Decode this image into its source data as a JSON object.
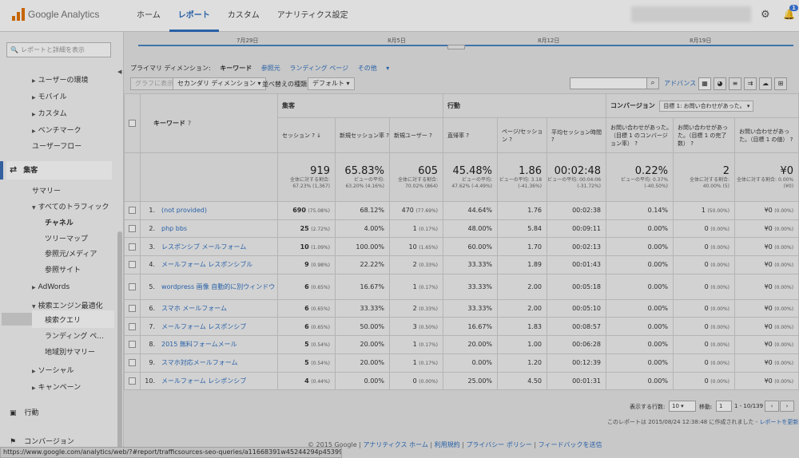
{
  "app": {
    "logo_text": "Google Analytics",
    "account_blurred": "▒▒▒▒▒▒▒▒▒▒▒▒▒▒▒▒▒▒",
    "bell_count": "1"
  },
  "nav": {
    "home": "ホーム",
    "reports": "レポート",
    "custom": "カスタム",
    "admin": "アナリティクス設定"
  },
  "sidebar": {
    "search_placeholder": "レポートと詳細を表示",
    "items": [
      "ユーザーの環境",
      "モバイル",
      "カスタム",
      "ベンチマーク",
      "ユーザーフロー",
      "集客",
      "サマリー",
      "すべてのトラフィック",
      "チャネル",
      "ツリーマップ",
      "参照元/メディア",
      "参照サイト",
      "AdWords",
      "検索エンジン最適化",
      "検索クエリ",
      "ランディング ペ...",
      "地域別サマリー",
      "ソーシャル",
      "キャンペーン",
      "行動",
      "コンバージョン"
    ]
  },
  "timeline": {
    "dates": [
      "7月29日",
      "8月5日",
      "8月12日",
      "8月19日"
    ]
  },
  "dimension": {
    "label": "プライマリ ディメンション:",
    "current": "キーワード",
    "options": [
      "参照元",
      "ランディング ページ",
      "その他"
    ]
  },
  "toolbar": {
    "plot": "グラフに表示",
    "secondary": "セカンダリ ディメンション",
    "sort_label": "並べ替えの種類:",
    "sort_value": "デフォルト",
    "advanced": "アドバンス"
  },
  "table": {
    "group_acq": "集客",
    "group_beh": "行動",
    "group_conv": "コンバージョン",
    "conv_select": "目標 1: お問い合わせがあった。",
    "col_keyword": "キーワード",
    "cols": [
      "セッション",
      "新規セッション率",
      "新規ユーザー",
      "直帰率",
      "ページ/セッション",
      "平均セッション時間",
      "お問い合わせがあった。（目標 1 のコンバージョン率）",
      "お問い合わせがあった。（目標 1 の完了数）",
      "お問い合わせがあった。（目標 1 の値）"
    ],
    "summary": [
      {
        "big": "919",
        "sm": "全体に対する割合: 67.23% (1,367)"
      },
      {
        "big": "65.83%",
        "sm": "ビューの平均: 63.20% (4.16%)"
      },
      {
        "big": "605",
        "sm": "全体に対する割合: 70.02% (864)"
      },
      {
        "big": "45.48%",
        "sm": "ビューの平均: 47.62% (-4.49%)"
      },
      {
        "big": "1.86",
        "sm": "ビューの平均: 3.18 (-41.36%)"
      },
      {
        "big": "00:02:48",
        "sm": "ビューの平均: 00:04:06 (-31.72%)"
      },
      {
        "big": "0.22%",
        "sm": "ビューの平均: 0.37% (-40.50%)"
      },
      {
        "big": "2",
        "sm": "全体に対する割合: 40.00% (5)"
      },
      {
        "big": "¥0",
        "sm": "全体に対する割合: 0.00% (¥0)"
      }
    ],
    "rows": [
      {
        "n": "1.",
        "kw": "(not provided)",
        "s": "690",
        "sp": "(75.08%)",
        "nsr": "68.12%",
        "nu": "470",
        "nup": "(77.69%)",
        "br": "44.64%",
        "pps": "1.76",
        "ast": "00:02:38",
        "cr": "0.14%",
        "gc": "1",
        "gcp": "(50.00%)",
        "gv": "¥0",
        "gvp": "(0.00%)"
      },
      {
        "n": "2.",
        "kw": "php bbs",
        "s": "25",
        "sp": "(2.72%)",
        "nsr": "4.00%",
        "nu": "1",
        "nup": "(0.17%)",
        "br": "48.00%",
        "pps": "5.84",
        "ast": "00:09:11",
        "cr": "0.00%",
        "gc": "0",
        "gcp": "(0.00%)",
        "gv": "¥0",
        "gvp": "(0.00%)"
      },
      {
        "n": "3.",
        "kw": "レスポンシブ メールフォーム",
        "s": "10",
        "sp": "(1.09%)",
        "nsr": "100.00%",
        "nu": "10",
        "nup": "(1.65%)",
        "br": "60.00%",
        "pps": "1.70",
        "ast": "00:02:13",
        "cr": "0.00%",
        "gc": "0",
        "gcp": "(0.00%)",
        "gv": "¥0",
        "gvp": "(0.00%)"
      },
      {
        "n": "4.",
        "kw": "メールフォーム レスポンシブル",
        "s": "9",
        "sp": "(0.98%)",
        "nsr": "22.22%",
        "nu": "2",
        "nup": "(0.33%)",
        "br": "33.33%",
        "pps": "1.89",
        "ast": "00:01:43",
        "cr": "0.00%",
        "gc": "0",
        "gcp": "(0.00%)",
        "gv": "¥0",
        "gvp": "(0.00%)"
      },
      {
        "n": "5.",
        "kw": "wordpress 画像 自動的に別ウィンドウ",
        "s": "6",
        "sp": "(0.65%)",
        "nsr": "16.67%",
        "nu": "1",
        "nup": "(0.17%)",
        "br": "33.33%",
        "pps": "2.00",
        "ast": "00:05:18",
        "cr": "0.00%",
        "gc": "0",
        "gcp": "(0.00%)",
        "gv": "¥0",
        "gvp": "(0.00%)"
      },
      {
        "n": "6.",
        "kw": "スマホ メールフォーム",
        "s": "6",
        "sp": "(0.65%)",
        "nsr": "33.33%",
        "nu": "2",
        "nup": "(0.33%)",
        "br": "33.33%",
        "pps": "2.00",
        "ast": "00:05:10",
        "cr": "0.00%",
        "gc": "0",
        "gcp": "(0.00%)",
        "gv": "¥0",
        "gvp": "(0.00%)"
      },
      {
        "n": "7.",
        "kw": "メールフォーム レスポンシブ",
        "s": "6",
        "sp": "(0.65%)",
        "nsr": "50.00%",
        "nu": "3",
        "nup": "(0.50%)",
        "br": "16.67%",
        "pps": "1.83",
        "ast": "00:08:57",
        "cr": "0.00%",
        "gc": "0",
        "gcp": "(0.00%)",
        "gv": "¥0",
        "gvp": "(0.00%)"
      },
      {
        "n": "8.",
        "kw": "2015 無料フォームメール",
        "s": "5",
        "sp": "(0.54%)",
        "nsr": "20.00%",
        "nu": "1",
        "nup": "(0.17%)",
        "br": "20.00%",
        "pps": "1.00",
        "ast": "00:06:28",
        "cr": "0.00%",
        "gc": "0",
        "gcp": "(0.00%)",
        "gv": "¥0",
        "gvp": "(0.00%)"
      },
      {
        "n": "9.",
        "kw": "スマホ対応メールフォーム",
        "s": "5",
        "sp": "(0.54%)",
        "nsr": "20.00%",
        "nu": "1",
        "nup": "(0.17%)",
        "br": "0.00%",
        "pps": "1.20",
        "ast": "00:12:39",
        "cr": "0.00%",
        "gc": "0",
        "gcp": "(0.00%)",
        "gv": "¥0",
        "gvp": "(0.00%)"
      },
      {
        "n": "10.",
        "kw": "メールフォーム レシポンシブ",
        "s": "4",
        "sp": "(0.44%)",
        "nsr": "0.00%",
        "nu": "0",
        "nup": "(0.00%)",
        "br": "25.00%",
        "pps": "4.50",
        "ast": "00:01:31",
        "cr": "0.00%",
        "gc": "0",
        "gcp": "(0.00%)",
        "gv": "¥0",
        "gvp": "(0.00%)"
      }
    ]
  },
  "pager": {
    "rows_label": "表示する行数:",
    "rows_value": "10",
    "goto_label": "移動:",
    "goto_value": "1",
    "range": "1 - 10/139"
  },
  "created": {
    "text": "このレポートは 2015/08/24 12:38:48 に作成されました - ",
    "refresh": "レポートを更新"
  },
  "footer": {
    "copy": "© 2015 Google",
    "links": [
      "アナリティクス ホーム",
      "利用規約",
      "プライバシー ポリシー",
      "フィードバックを送信"
    ]
  },
  "status": {
    "url": "https://www.google.com/analytics/web/?#report/trafficsources-seo-queries/a11668391w45244294p45399683/"
  }
}
